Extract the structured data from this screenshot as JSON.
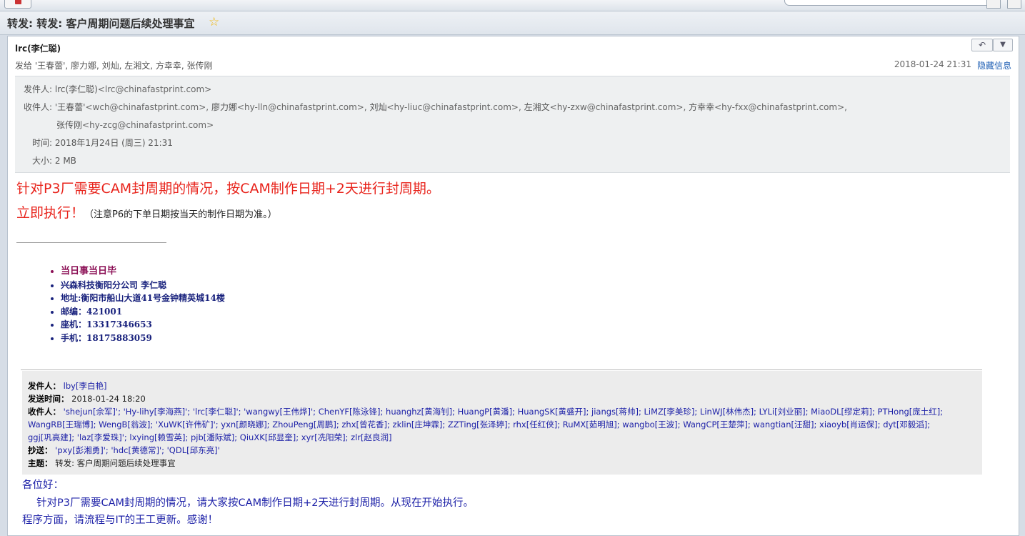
{
  "subject_bar": {
    "title": "转发: 转发: 客户周期问题后续处理事宜",
    "star": "☆"
  },
  "message": {
    "from_name": "lrc(李仁聪)",
    "recipients_summary": "发给 '王春蕾', 廖力娜, 刘灿, 左湘文, 方幸幸, 张传刚",
    "date_short": "2018-01-24 21:31",
    "hide_info": "隐藏信息",
    "reply_icon": "reply-icon",
    "more_icon": "chevron-down-icon"
  },
  "header_details": {
    "sender_label": "发件人:",
    "sender_name": "lrc(李仁聪)",
    "sender_email": "<lrc@chinafastprint.com>",
    "to_label": "收件人:",
    "to_line1": [
      {
        "name": "'王春蕾'",
        "email": "<wch@chinafastprint.com>,"
      },
      {
        "name": "廖力娜",
        "email": "<hy-lln@chinafastprint.com>,"
      },
      {
        "name": "刘灿",
        "email": "<hy-liuc@chinafastprint.com>,"
      },
      {
        "name": "左湘文",
        "email": "<hy-zxw@chinafastprint.com>,"
      },
      {
        "name": "方幸幸",
        "email": "<hy-fxx@chinafastprint.com>,"
      }
    ],
    "to_line2_name": "张传刚",
    "to_line2_email": "<hy-zcg@chinafastprint.com>",
    "time_label": "时间:",
    "time_value": "2018年1月24日 (周三) 21:31",
    "size_label": "大小:",
    "size_value": "2 MB"
  },
  "body": {
    "line1": "针对P3厂需要CAM封周期的情况，按CAM制作日期+2天进行封周期。",
    "line2": "立即执行！",
    "line2_note": "（注意P6的下单日期按当天的制作日期为准。）"
  },
  "signature": [
    "当日事当日毕",
    "兴森科技衡阳分公司    李仁聪",
    "地址:衡阳市船山大道41号金钟精英城14楼",
    "邮编：421001",
    "座机：13317346653",
    "手机：18175883059"
  ],
  "quoted_header": {
    "from_label": "发件人：",
    "from_value": "lby[李白艳]",
    "sent_label": "发送时间：",
    "sent_value": "2018-01-24 18:20",
    "to_label": "收件人：",
    "to_line1": "'shejun[佘军]'; 'Hy-lihy[李海燕]'; 'lrc[李仁聪]'; 'wangwy[王伟烨]'; ChenYF[陈泳锋]; huanghz[黄海钊]; HuangP[黄潘]; HuangSK[黄盛开]; jiangs[蒋帅]; LiMZ[李美珍]; LinWJ[林伟杰]; LYLi[刘业丽]; MiaoDL[缪定莉]; PTHong[庞土红];",
    "to_line2": "WangRB[王瑞博]; WengB[翁波]; 'XuWK[许伟矿]'; yxn[颜晓娜]; ZhouPeng[周鹏]; zhx[曾花香]; zklin[庄坤霖]; ZZTing[张泽婷]; rhx[任红侠]; RuMX[茹明旭]; wangbo[王波]; WangCP[王楚萍]; wangtian[汪甜]; xiaoyb[肖运保]; dyt[邓毅滔];",
    "to_line3": "ggj[巩高建]; 'laz[李爱珠]'; lxying[赖雪英]; pjb[潘际斌]; QiuXK[邱显奎]; xyr[冼阳荣]; zlr[赵良润]",
    "cc_label": "抄送：",
    "cc_value": "'pxy[彭湘勇]'; 'hdc[黄德常]'; 'QDL[邱东亮]'",
    "subject_label": "主题：",
    "subject_value": "转发: 客户周期问题后续处理事宜"
  },
  "reply_body": {
    "greeting": "各位好：",
    "line1": "针对P3厂需要CAM封周期的情况，请大家按CAM制作日期+2天进行封周期。从现在开始执行。",
    "line2": "程序方面，请流程与IT的王工更新。感谢！"
  }
}
